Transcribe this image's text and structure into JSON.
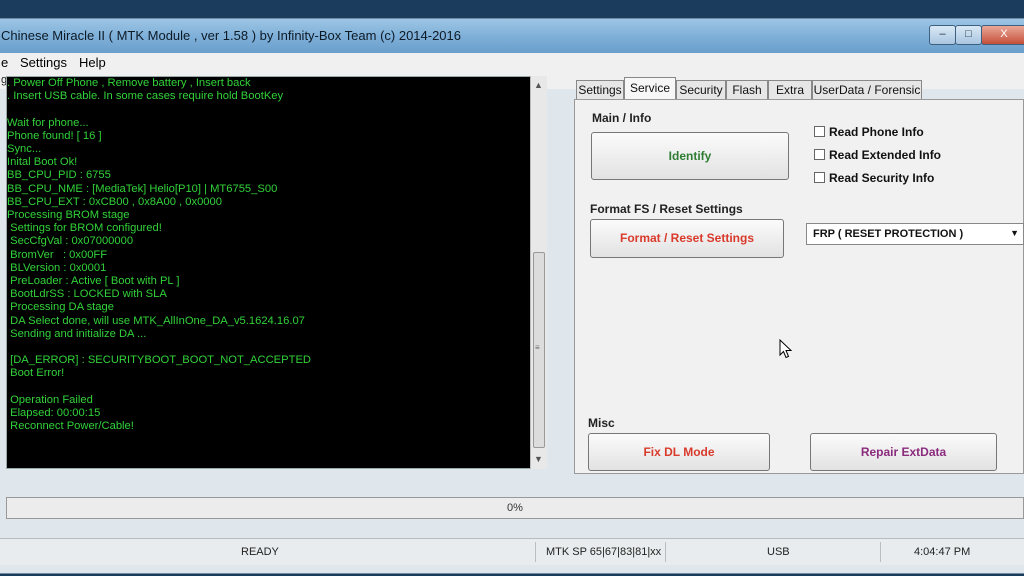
{
  "window": {
    "title": "Chinese Miracle II ( MTK Module , ver 1.58 ) by Infinity-Box Team (c) 2014-2016",
    "controls": {
      "minimize": "–",
      "maximize": "□",
      "close": "X"
    }
  },
  "menu": [
    "e",
    "Settings",
    "Help"
  ],
  "subbar_text": "g",
  "log": {
    "lines": [
      ". Power Off Phone , Remove battery , Insert back",
      ". Insert USB cable. In some cases require hold BootKey",
      "",
      "Wait for phone...",
      "Phone found! [ 16 ]",
      "Sync...",
      "Inital Boot Ok!",
      "BB_CPU_PID : 6755",
      "BB_CPU_NME : [MediaTek] Helio[P10] | MT6755_S00",
      "BB_CPU_EXT : 0xCB00 , 0x8A00 , 0x0000",
      "Processing BROM stage",
      " Settings for BROM configured!",
      " SecCfgVal : 0x07000000",
      " BromVer   : 0x00FF",
      " BLVersion : 0x0001",
      " PreLoader : Active [ Boot with PL ]",
      " BootLdrSS : LOCKED with SLA",
      " Processing DA stage",
      " DA Select done, will use MTK_AllInOne_DA_v5.1624.16.07",
      " Sending and initialize DA ...",
      "",
      " [DA_ERROR] : SECURITYBOOT_BOOT_NOT_ACCEPTED",
      " Boot Error!",
      "",
      " Operation Failed",
      " Elapsed: 00:00:15",
      " Reconnect Power/Cable!"
    ]
  },
  "tabs": [
    {
      "label": "Settings",
      "active": false
    },
    {
      "label": "Service",
      "active": true
    },
    {
      "label": "Security",
      "active": false
    },
    {
      "label": "Flash",
      "active": false
    },
    {
      "label": "Extra",
      "active": false
    },
    {
      "label": "UserData / Forensic",
      "active": false
    }
  ],
  "service": {
    "main_info_label": "Main / Info",
    "identify_label": "Identify",
    "checkboxes": [
      {
        "label": "Read Phone Info",
        "checked": false
      },
      {
        "label": "Read Extended Info",
        "checked": false
      },
      {
        "label": "Read Security Info",
        "checked": false
      }
    ],
    "format_label": "Format FS / Reset Settings",
    "format_button": "Format / Reset Settings",
    "frp_select": "FRP ( RESET PROTECTION )",
    "misc_label": "Misc",
    "fix_dl_button": "Fix DL Mode",
    "repair_button": "Repair ExtData"
  },
  "progress": {
    "value": 0,
    "text": "0%"
  },
  "status": {
    "state": "READY",
    "platform": "MTK SP 65|67|83|81|xx",
    "connection": "USB",
    "time": "4:04:47 PM"
  },
  "colors": {
    "log_text": "#32d23a",
    "identify": "#2f7d33",
    "format": "#d93a2b",
    "fix_dl": "#d93a2b",
    "repair": "#8a2b7d"
  }
}
